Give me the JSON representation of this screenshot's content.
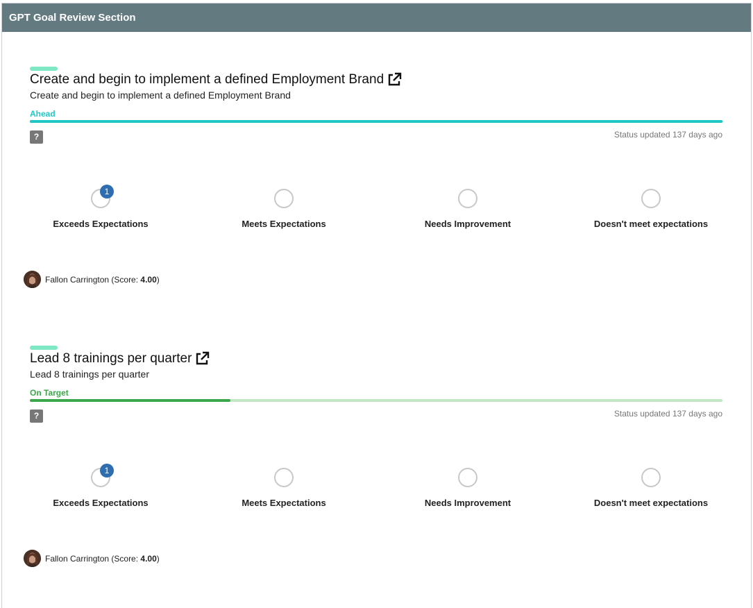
{
  "header": {
    "title": "GPT Goal Review Section"
  },
  "goals": [
    {
      "title": "Create and begin to implement a defined Employment Brand",
      "external_link_icon": "external-link-icon",
      "description": "Create and begin to implement a defined Employment Brand",
      "status": "Ahead",
      "status_color": "#1fc7c7",
      "progress": 1.0,
      "progress_track_color": "#1fc7c7",
      "help_label": "?",
      "status_updated": "Status updated 137 days ago",
      "ratings": [
        {
          "label": "Exceeds Expectations",
          "count": "1"
        },
        {
          "label": "Meets Expectations",
          "count": null
        },
        {
          "label": "Needs Improvement",
          "count": null
        },
        {
          "label": "Doesn't meet expectations",
          "count": null
        }
      ],
      "reviewer": {
        "name": "Fallon Carrington",
        "score_prefix": "(Score: ",
        "score": "4.00",
        "score_suffix": ")"
      }
    },
    {
      "title": "Lead 8 trainings per quarter",
      "external_link_icon": "external-link-icon",
      "description": "Lead 8 trainings per quarter",
      "status": "On Target",
      "status_color": "#3aa84a",
      "progress": 0.29,
      "progress_track_color": "#c3e6c5",
      "help_label": "?",
      "status_updated": "Status updated 137 days ago",
      "ratings": [
        {
          "label": "Exceeds Expectations",
          "count": "1"
        },
        {
          "label": "Meets Expectations",
          "count": null
        },
        {
          "label": "Needs Improvement",
          "count": null
        },
        {
          "label": "Doesn't meet expectations",
          "count": null
        }
      ],
      "reviewer": {
        "name": "Fallon Carrington",
        "score_prefix": "(Score: ",
        "score": "4.00",
        "score_suffix": ")"
      }
    }
  ]
}
